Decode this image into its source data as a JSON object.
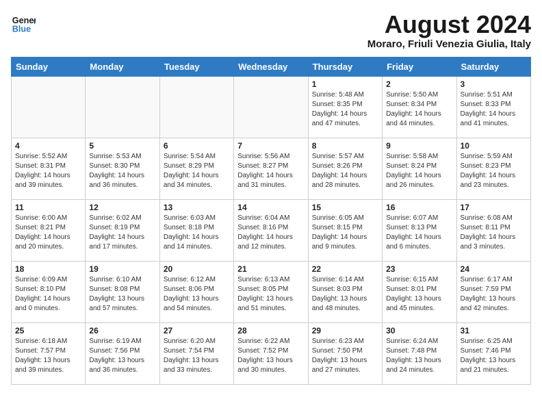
{
  "header": {
    "logo_line1": "General",
    "logo_line2": "Blue",
    "month_year": "August 2024",
    "location": "Moraro, Friuli Venezia Giulia, Italy"
  },
  "days_of_week": [
    "Sunday",
    "Monday",
    "Tuesday",
    "Wednesday",
    "Thursday",
    "Friday",
    "Saturday"
  ],
  "weeks": [
    [
      {
        "num": "",
        "info": ""
      },
      {
        "num": "",
        "info": ""
      },
      {
        "num": "",
        "info": ""
      },
      {
        "num": "",
        "info": ""
      },
      {
        "num": "1",
        "info": "Sunrise: 5:48 AM\nSunset: 8:35 PM\nDaylight: 14 hours\nand 47 minutes."
      },
      {
        "num": "2",
        "info": "Sunrise: 5:50 AM\nSunset: 8:34 PM\nDaylight: 14 hours\nand 44 minutes."
      },
      {
        "num": "3",
        "info": "Sunrise: 5:51 AM\nSunset: 8:33 PM\nDaylight: 14 hours\nand 41 minutes."
      }
    ],
    [
      {
        "num": "4",
        "info": "Sunrise: 5:52 AM\nSunset: 8:31 PM\nDaylight: 14 hours\nand 39 minutes."
      },
      {
        "num": "5",
        "info": "Sunrise: 5:53 AM\nSunset: 8:30 PM\nDaylight: 14 hours\nand 36 minutes."
      },
      {
        "num": "6",
        "info": "Sunrise: 5:54 AM\nSunset: 8:29 PM\nDaylight: 14 hours\nand 34 minutes."
      },
      {
        "num": "7",
        "info": "Sunrise: 5:56 AM\nSunset: 8:27 PM\nDaylight: 14 hours\nand 31 minutes."
      },
      {
        "num": "8",
        "info": "Sunrise: 5:57 AM\nSunset: 8:26 PM\nDaylight: 14 hours\nand 28 minutes."
      },
      {
        "num": "9",
        "info": "Sunrise: 5:58 AM\nSunset: 8:24 PM\nDaylight: 14 hours\nand 26 minutes."
      },
      {
        "num": "10",
        "info": "Sunrise: 5:59 AM\nSunset: 8:23 PM\nDaylight: 14 hours\nand 23 minutes."
      }
    ],
    [
      {
        "num": "11",
        "info": "Sunrise: 6:00 AM\nSunset: 8:21 PM\nDaylight: 14 hours\nand 20 minutes."
      },
      {
        "num": "12",
        "info": "Sunrise: 6:02 AM\nSunset: 8:19 PM\nDaylight: 14 hours\nand 17 minutes."
      },
      {
        "num": "13",
        "info": "Sunrise: 6:03 AM\nSunset: 8:18 PM\nDaylight: 14 hours\nand 14 minutes."
      },
      {
        "num": "14",
        "info": "Sunrise: 6:04 AM\nSunset: 8:16 PM\nDaylight: 14 hours\nand 12 minutes."
      },
      {
        "num": "15",
        "info": "Sunrise: 6:05 AM\nSunset: 8:15 PM\nDaylight: 14 hours\nand 9 minutes."
      },
      {
        "num": "16",
        "info": "Sunrise: 6:07 AM\nSunset: 8:13 PM\nDaylight: 14 hours\nand 6 minutes."
      },
      {
        "num": "17",
        "info": "Sunrise: 6:08 AM\nSunset: 8:11 PM\nDaylight: 14 hours\nand 3 minutes."
      }
    ],
    [
      {
        "num": "18",
        "info": "Sunrise: 6:09 AM\nSunset: 8:10 PM\nDaylight: 14 hours\nand 0 minutes."
      },
      {
        "num": "19",
        "info": "Sunrise: 6:10 AM\nSunset: 8:08 PM\nDaylight: 13 hours\nand 57 minutes."
      },
      {
        "num": "20",
        "info": "Sunrise: 6:12 AM\nSunset: 8:06 PM\nDaylight: 13 hours\nand 54 minutes."
      },
      {
        "num": "21",
        "info": "Sunrise: 6:13 AM\nSunset: 8:05 PM\nDaylight: 13 hours\nand 51 minutes."
      },
      {
        "num": "22",
        "info": "Sunrise: 6:14 AM\nSunset: 8:03 PM\nDaylight: 13 hours\nand 48 minutes."
      },
      {
        "num": "23",
        "info": "Sunrise: 6:15 AM\nSunset: 8:01 PM\nDaylight: 13 hours\nand 45 minutes."
      },
      {
        "num": "24",
        "info": "Sunrise: 6:17 AM\nSunset: 7:59 PM\nDaylight: 13 hours\nand 42 minutes."
      }
    ],
    [
      {
        "num": "25",
        "info": "Sunrise: 6:18 AM\nSunset: 7:57 PM\nDaylight: 13 hours\nand 39 minutes."
      },
      {
        "num": "26",
        "info": "Sunrise: 6:19 AM\nSunset: 7:56 PM\nDaylight: 13 hours\nand 36 minutes."
      },
      {
        "num": "27",
        "info": "Sunrise: 6:20 AM\nSunset: 7:54 PM\nDaylight: 13 hours\nand 33 minutes."
      },
      {
        "num": "28",
        "info": "Sunrise: 6:22 AM\nSunset: 7:52 PM\nDaylight: 13 hours\nand 30 minutes."
      },
      {
        "num": "29",
        "info": "Sunrise: 6:23 AM\nSunset: 7:50 PM\nDaylight: 13 hours\nand 27 minutes."
      },
      {
        "num": "30",
        "info": "Sunrise: 6:24 AM\nSunset: 7:48 PM\nDaylight: 13 hours\nand 24 minutes."
      },
      {
        "num": "31",
        "info": "Sunrise: 6:25 AM\nSunset: 7:46 PM\nDaylight: 13 hours\nand 21 minutes."
      }
    ]
  ]
}
